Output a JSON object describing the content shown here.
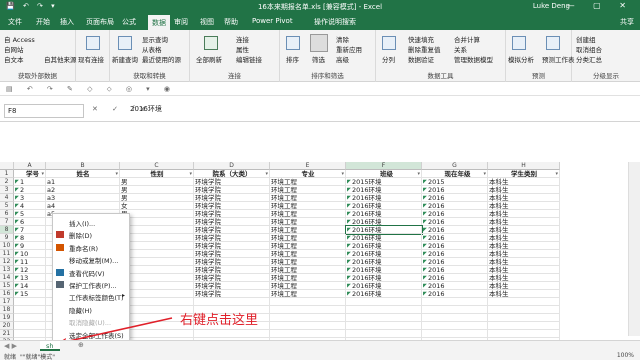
{
  "window": {
    "title": "16本来期报名单.xls [兼容模式] - Excel",
    "user": "Luke Deng",
    "controls": [
      "—",
      "▢",
      "✕"
    ]
  },
  "ribbon_tabs": [
    {
      "label": "文件"
    },
    {
      "label": "开始"
    },
    {
      "label": "插入"
    },
    {
      "label": "页面布局"
    },
    {
      "label": "公式"
    },
    {
      "label": "数据",
      "active": true
    },
    {
      "label": "审阅"
    },
    {
      "label": "视图"
    },
    {
      "label": "帮助"
    },
    {
      "label": "Power Pivot"
    },
    {
      "label": "操作说明搜索"
    }
  ],
  "share_label": "共享",
  "ribbon": {
    "get_external": {
      "label": "获取外部数据",
      "items": [
        "自 Access",
        "自网站",
        "自文本",
        "自其他来源",
        "现有连接"
      ]
    },
    "get_transform": {
      "label": "获取和转换",
      "items": [
        "新建查询",
        "显示查询",
        "从表格",
        "最近使用的源"
      ]
    },
    "connections": {
      "label": "连接",
      "items": [
        "全部刷新",
        "连接",
        "属性",
        "编辑链接"
      ]
    },
    "sort_filter": {
      "label": "排序和筛选",
      "items": [
        "排序",
        "筛选",
        "清除",
        "重新应用",
        "高级"
      ]
    },
    "data_tools": {
      "label": "数据工具",
      "items": [
        "分列",
        "快速填充",
        "删除重复值",
        "数据验证",
        "合并计算",
        "关系",
        "管理数据模型"
      ]
    },
    "forecast": {
      "label": "预测",
      "items": [
        "模拟分析",
        "预测工作表"
      ]
    },
    "outline": {
      "label": "分级显示",
      "items": [
        "创建组",
        "取消组合",
        "分类汇总"
      ]
    }
  },
  "formula_bar": {
    "name_box": "F8",
    "value": "2016环境"
  },
  "columns": [
    "A",
    "B",
    "C",
    "D",
    "E",
    "F",
    "G",
    "H"
  ],
  "headers": [
    "学号",
    "姓名",
    "性别",
    "院系（大类）",
    "专业",
    "班级",
    "现在年级",
    "学生类别"
  ],
  "rows": [
    [
      "1",
      "a1",
      "男",
      "环境学院",
      "环境工程",
      "2015环境",
      "2015",
      "本科生"
    ],
    [
      "2",
      "a2",
      "男",
      "环境学院",
      "环境工程",
      "2016环境",
      "2016",
      "本科生"
    ],
    [
      "3",
      "a3",
      "男",
      "环境学院",
      "环境工程",
      "2016环境",
      "2016",
      "本科生"
    ],
    [
      "4",
      "a4",
      "女",
      "环境学院",
      "环境工程",
      "2016环境",
      "2016",
      "本科生"
    ],
    [
      "5",
      "a5",
      "男",
      "环境学院",
      "环境工程",
      "2016环境",
      "2016",
      "本科生"
    ],
    [
      "6",
      "",
      "男",
      "环境学院",
      "环境工程",
      "2016环境",
      "2016",
      "本科生"
    ],
    [
      "7",
      "",
      "女",
      "环境学院",
      "环境工程",
      "2016环境",
      "2016",
      "本科生"
    ],
    [
      "8",
      "",
      "男",
      "环境学院",
      "环境工程",
      "2016环境",
      "2016",
      "本科生"
    ],
    [
      "9",
      "",
      "男",
      "环境学院",
      "环境工程",
      "2016环境",
      "2016",
      "本科生"
    ],
    [
      "10",
      "",
      "男",
      "环境学院",
      "环境工程",
      "2016环境",
      "2016",
      "本科生"
    ],
    [
      "11",
      "",
      "男",
      "环境学院",
      "环境工程",
      "2016环境",
      "2016",
      "本科生"
    ],
    [
      "12",
      "",
      "男",
      "环境学院",
      "环境工程",
      "2016环境",
      "2016",
      "本科生"
    ],
    [
      "13",
      "",
      "男",
      "环境学院",
      "环境工程",
      "2016环境",
      "2016",
      "本科生"
    ],
    [
      "14",
      "",
      "男",
      "环境学院",
      "环境工程",
      "2016环境",
      "2016",
      "本科生"
    ],
    [
      "15",
      "",
      "男",
      "环境学院",
      "环境工程",
      "2016环境",
      "2016",
      "本科生"
    ]
  ],
  "row_numbers": [
    "1",
    "2",
    "3",
    "4",
    "5",
    "6",
    "7",
    "8",
    "9",
    "10",
    "11",
    "12",
    "13",
    "14",
    "15",
    "16",
    "17",
    "18",
    "19",
    "20",
    "21",
    "22"
  ],
  "context_menu": [
    {
      "label": "插入(I)...",
      "disabled": false
    },
    {
      "label": "删除(D)",
      "disabled": false
    },
    {
      "label": "重命名(R)",
      "disabled": false
    },
    {
      "label": "移动或复制(M)...",
      "disabled": false
    },
    {
      "label": "查看代码(V)",
      "disabled": false
    },
    {
      "label": "保护工作表(P)...",
      "disabled": false
    },
    {
      "label": "工作表标签颜色(T)",
      "disabled": false,
      "submenu": true
    },
    {
      "label": "隐藏(H)",
      "disabled": false
    },
    {
      "label": "取消隐藏(U)...",
      "disabled": true
    },
    {
      "label": "选定全部工作表(S)",
      "disabled": false
    }
  ],
  "sheet_tab": "sh",
  "status": {
    "left": "就绪",
    "mode": "\"\"就绪\"模式\"",
    "zoom": "100%"
  },
  "annotation": "右键点击这里"
}
